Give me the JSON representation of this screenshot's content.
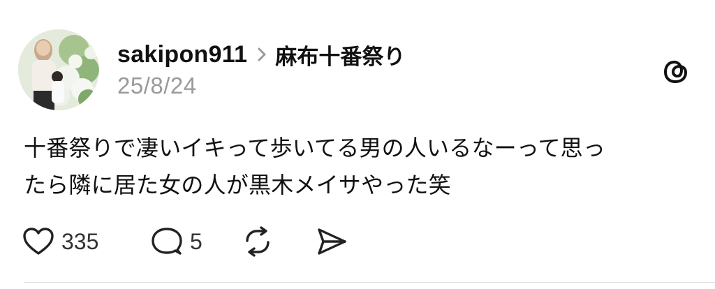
{
  "post": {
    "username": "sakipon911",
    "topic": "麻布十番祭り",
    "date": "25/8/24",
    "body_lines": [
      "十番祭りで凄いイキって歩いてる男の人いるなーって思っ",
      "たら隣に居た女の人が黒木メイサやった笑"
    ],
    "likes": "335",
    "replies": "5"
  },
  "icons": {
    "avatar": "profile-photo",
    "chevron": "chevron-right-icon",
    "logo": "threads-logo-icon",
    "like": "heart-icon",
    "reply": "comment-bubble-icon",
    "repost": "repost-icon",
    "share": "send-icon"
  },
  "colors": {
    "text": "#111111",
    "secondary": "#9a9a9a",
    "divider": "#dddddd"
  }
}
